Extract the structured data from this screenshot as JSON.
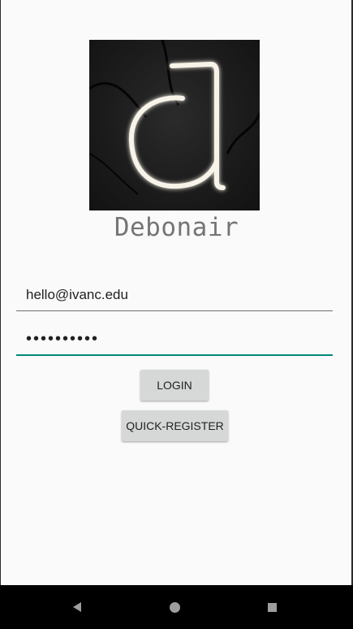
{
  "app": {
    "title": "Debonair",
    "logo_icon": "neon-letter-d-logo"
  },
  "login_form": {
    "email_value": "hello@ivanc.edu",
    "password_value": "••••••••••",
    "login_label": "LOGIN",
    "register_label": "QUICK-REGISTER"
  },
  "navigation_bar": {
    "back_icon": "back-triangle-icon",
    "home_icon": "home-circle-icon",
    "recents_icon": "recents-square-icon"
  },
  "colors": {
    "background": "#fafafa",
    "accent": "#00897b",
    "button": "#d6d7d7",
    "title_text": "#757575",
    "navbar": "#000000"
  }
}
